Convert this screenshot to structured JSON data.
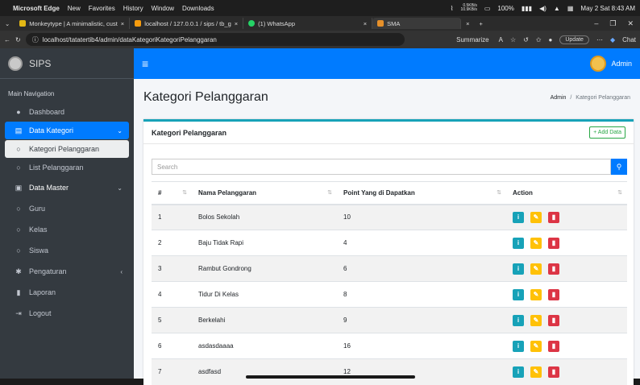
{
  "macbar": {
    "app": "Microsoft Edge",
    "menus": [
      "New",
      "Favorites",
      "History",
      "Window",
      "Downloads"
    ],
    "net_up": "0.5KB/s",
    "net_down": "10.9KB/s",
    "battery": "100%",
    "datetime": "May 2 Sat 8:43 AM"
  },
  "tabs": [
    {
      "label": "Monkeytype | A minimalistic, cust",
      "close": "×",
      "color": "#e2b714"
    },
    {
      "label": "localhost / 127.0.0.1 / sips / tb_g",
      "close": "×",
      "color": "#f89c0e"
    },
    {
      "label": "(1) WhatsApp",
      "close": "",
      "color": "#25d366"
    },
    {
      "label": "SMA",
      "close": "×",
      "color": "#e6902a"
    }
  ],
  "address": {
    "url": "localhost/tatatertib4/admin/dataKategoriKategoriPelanggaran",
    "summarize": "Summarize",
    "update": "Update",
    "copilot": "Chat"
  },
  "sidebar": {
    "brand": "SIPS",
    "heading": "Main Navigation",
    "items": [
      {
        "label": "Dashboard",
        "icon": "tachometer-icon",
        "glyph": "●"
      },
      {
        "label": "Data Kategori",
        "icon": "folder-icon",
        "glyph": "▤"
      },
      {
        "label": "Kategori Pelanggaran",
        "icon": "circle-outline-icon",
        "glyph": "○"
      },
      {
        "label": "List Pelanggaran",
        "icon": "circle-outline-icon",
        "glyph": "○"
      },
      {
        "label": "Data Master",
        "icon": "id-card-icon",
        "glyph": "▣"
      },
      {
        "label": "Guru",
        "icon": "circle-outline-icon",
        "glyph": "○"
      },
      {
        "label": "Kelas",
        "icon": "circle-outline-icon",
        "glyph": "○"
      },
      {
        "label": "Siswa",
        "icon": "circle-outline-icon",
        "glyph": "○"
      },
      {
        "label": "Pengaturan",
        "icon": "gear-icon",
        "glyph": "✱"
      },
      {
        "label": "Laporan",
        "icon": "file-icon",
        "glyph": "▮"
      },
      {
        "label": "Logout",
        "icon": "sign-out-icon",
        "glyph": "⇥"
      }
    ]
  },
  "navbar": {
    "user": "Admin"
  },
  "page": {
    "title": "Kategori Pelanggaran",
    "breadcrumb_home": "Admin",
    "breadcrumb_sep": "/",
    "breadcrumb_current": "Kategori Pelanggaran"
  },
  "card": {
    "title": "Kategori Pelanggaran",
    "add_label": "+ Add Data",
    "search_placeholder": "Search"
  },
  "table": {
    "columns": [
      "#",
      "Nama Pelanggaran",
      "Point Yang di Dapatkan",
      "Action"
    ],
    "rows": [
      {
        "no": "1",
        "name": "Bolos Sekolah",
        "point": "10"
      },
      {
        "no": "2",
        "name": "Baju Tidak Rapi",
        "point": "4"
      },
      {
        "no": "3",
        "name": "Rambut Gondrong",
        "point": "6"
      },
      {
        "no": "4",
        "name": "Tidur Di Kelas",
        "point": "8"
      },
      {
        "no": "5",
        "name": "Berkelahi",
        "point": "9"
      },
      {
        "no": "6",
        "name": "asdasdaaaa",
        "point": "16"
      },
      {
        "no": "7",
        "name": "asdfasd",
        "point": "12"
      }
    ]
  },
  "colors": {
    "primary": "#007bff",
    "info": "#17a2b8",
    "warning": "#ffc107",
    "danger": "#dc3545",
    "success": "#28a745"
  }
}
